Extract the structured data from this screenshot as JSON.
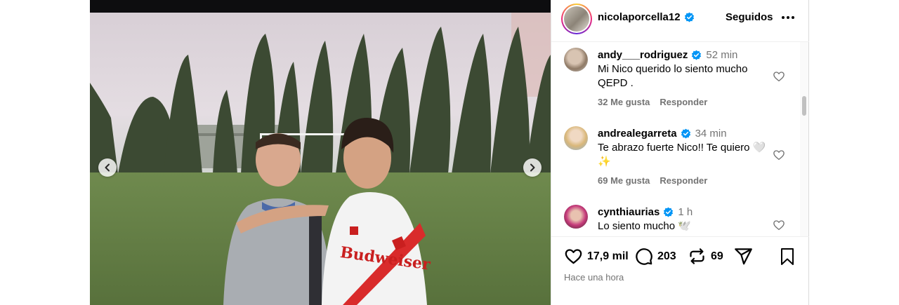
{
  "post": {
    "username": "nicolaporcella12",
    "follow_status": "Seguidos",
    "more_label": "Más opciones",
    "timestamp": "Hace una hora"
  },
  "comments": [
    {
      "user": "andy___rodriguez",
      "time": "52 min",
      "text": "Mi Nico querido lo siento mucho QEPD .",
      "likes": "32 Me gusta",
      "reply": "Responder"
    },
    {
      "user": "andrealegarreta",
      "time": "34 min",
      "text": "Te abrazo fuerte Nico!! Te quiero 🤍✨",
      "likes": "69 Me gusta",
      "reply": "Responder"
    },
    {
      "user": "cynthiaurias",
      "time": "1 h",
      "text": "Lo siento mucho 🕊️",
      "likes": "",
      "reply": ""
    }
  ],
  "stats": {
    "likes": "17,9 mil",
    "comments": "203",
    "reposts": "69"
  },
  "icons": {
    "verified": "verified-badge-icon",
    "like": "heart-icon",
    "comment": "comment-bubble-icon",
    "repost": "repost-icon",
    "share": "send-icon",
    "save": "bookmark-icon",
    "prev": "chevron-left-icon",
    "next": "chevron-right-icon"
  },
  "colors": {
    "verified": "#0095f6",
    "muted": "#737373"
  }
}
